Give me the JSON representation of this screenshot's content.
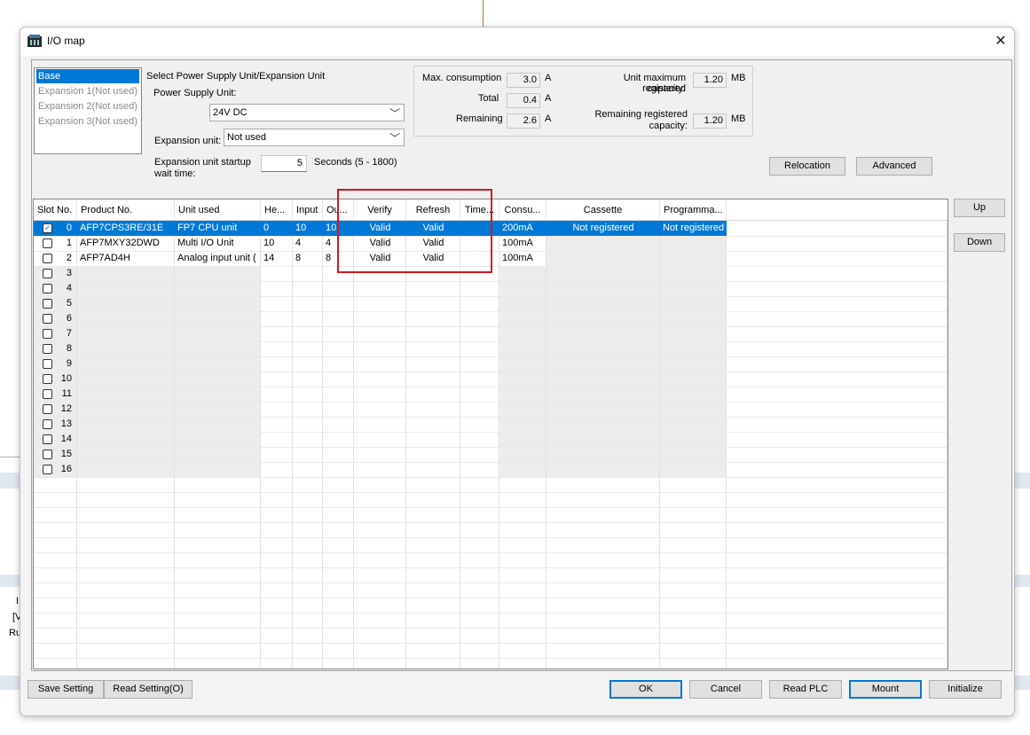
{
  "window": {
    "title": "I/O map"
  },
  "background": {
    "frag1": "I",
    "frag2": "[V",
    "frag3": "Ru"
  },
  "units_list": [
    {
      "label": "Base",
      "selected": true
    },
    {
      "label": "Expansion 1(Not used)",
      "selected": false
    },
    {
      "label": "Expansion 2(Not used)",
      "selected": false
    },
    {
      "label": "Expansion 3(Not used)",
      "selected": false
    }
  ],
  "settings": {
    "select_label": "Select Power Supply Unit/Expansion Unit",
    "power_supply_label": "Power Supply Unit:",
    "power_supply_value": "24V DC",
    "expansion_unit_label": "Expansion unit:",
    "expansion_unit_value": "Not used",
    "startup_label_1": "Expansion unit startup",
    "startup_label_2": "wait time:",
    "startup_value": "5",
    "startup_hint": "Seconds (5 - 1800)"
  },
  "consumption": {
    "max_label": "Max. consumption",
    "max_value": "3.0",
    "max_unit": "A",
    "total_label": "Total",
    "total_value": "0.4",
    "total_unit": "A",
    "remaining_label": "Remaining",
    "remaining_value": "2.6",
    "remaining_unit": "A",
    "cap_label_1": "Unit maximum registered",
    "cap_label_2": "capacity:",
    "cap_value": "1.20",
    "cap_unit": "MB",
    "rem_cap_label_1": "Remaining registered",
    "rem_cap_label_2": "capacity:",
    "rem_cap_value": "1.20",
    "rem_cap_unit": "MB"
  },
  "buttons": {
    "relocation": "Relocation",
    "advanced": "Advanced",
    "up": "Up",
    "down": "Down",
    "save_setting": "Save Setting",
    "read_setting": "Read Setting(O)",
    "ok": "OK",
    "cancel": "Cancel",
    "read_plc": "Read PLC",
    "mount": "Mount",
    "initialize": "Initialize"
  },
  "table": {
    "columns": [
      "Slot No.",
      "Product No.",
      "Unit used",
      "He...",
      "Input",
      "Ou...",
      "Verify",
      "Refresh",
      "Time...",
      "Consu...",
      "Cassette",
      "Programma..."
    ],
    "rows": [
      {
        "checked": true,
        "slot": "0",
        "product": "AFP7CPS3RE/31E",
        "unit": "FP7 CPU unit",
        "head": "0",
        "input": "10",
        "output": "10",
        "verify": "Valid",
        "refresh": "Valid",
        "time": "",
        "consumption": "200mA",
        "cassette": "Not registered",
        "program": "Not registered"
      },
      {
        "checked": false,
        "slot": "1",
        "product": "AFP7MXY32DWD",
        "unit": "Multi I/O Unit",
        "head": "10",
        "input": "4",
        "output": "4",
        "verify": "Valid",
        "refresh": "Valid",
        "time": "",
        "consumption": "100mA",
        "cassette": "",
        "program": ""
      },
      {
        "checked": false,
        "slot": "2",
        "product": "AFP7AD4H",
        "unit": "Analog input unit (",
        "head": "14",
        "input": "8",
        "output": "8",
        "verify": "Valid",
        "refresh": "Valid",
        "time": "",
        "consumption": "100mA",
        "cassette": "",
        "program": ""
      },
      {
        "checked": false,
        "slot": "3"
      },
      {
        "checked": false,
        "slot": "4"
      },
      {
        "checked": false,
        "slot": "5"
      },
      {
        "checked": false,
        "slot": "6"
      },
      {
        "checked": false,
        "slot": "7"
      },
      {
        "checked": false,
        "slot": "8"
      },
      {
        "checked": false,
        "slot": "9"
      },
      {
        "checked": false,
        "slot": "10"
      },
      {
        "checked": false,
        "slot": "11"
      },
      {
        "checked": false,
        "slot": "12"
      },
      {
        "checked": false,
        "slot": "13"
      },
      {
        "checked": false,
        "slot": "14"
      },
      {
        "checked": false,
        "slot": "15"
      },
      {
        "checked": false,
        "slot": "16"
      }
    ]
  },
  "colors": {
    "selection": "#0078d7",
    "highlight_box": "#d9161c",
    "disabled_cell": "#ececec"
  }
}
